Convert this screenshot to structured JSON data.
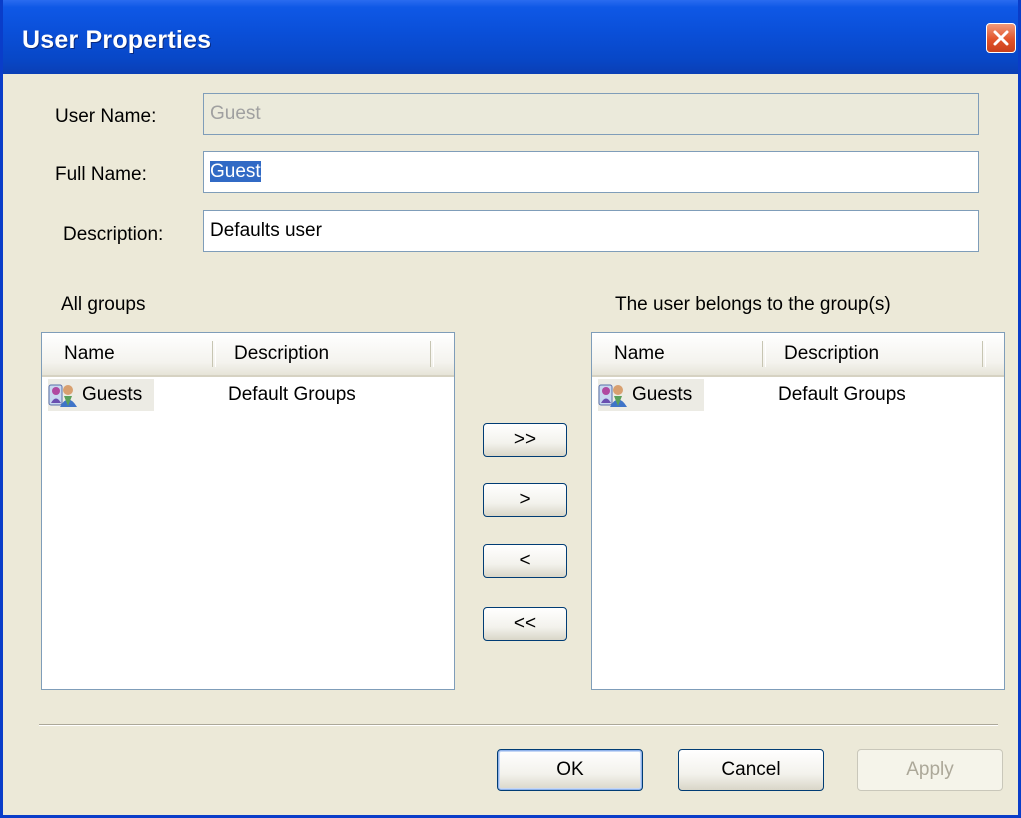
{
  "window": {
    "title": "User Properties"
  },
  "form": {
    "user_name_label": "User Name:",
    "user_name_value": "Guest",
    "full_name_label": "Full Name:",
    "full_name_value": "Guest",
    "description_label": "Description:",
    "description_value": "Defaults user"
  },
  "all_groups": {
    "label": "All groups",
    "columns": [
      "Name",
      "Description"
    ],
    "rows": [
      {
        "name": "Guests",
        "description": "Default Groups",
        "icon": "group-icon"
      }
    ]
  },
  "member_groups": {
    "label": "The user belongs to the group(s)",
    "columns": [
      "Name",
      "Description"
    ],
    "rows": [
      {
        "name": "Guests",
        "description": "Default Groups",
        "icon": "group-icon"
      }
    ]
  },
  "transfer_buttons": {
    "add_all": ">>",
    "add": ">",
    "remove": "<",
    "remove_all": "<<"
  },
  "buttons": {
    "ok": "OK",
    "cancel": "Cancel",
    "apply": "Apply"
  },
  "colors": {
    "titlebar": "#0a4fd8",
    "selection": "#316ac5",
    "close_button": "#e2542a"
  }
}
